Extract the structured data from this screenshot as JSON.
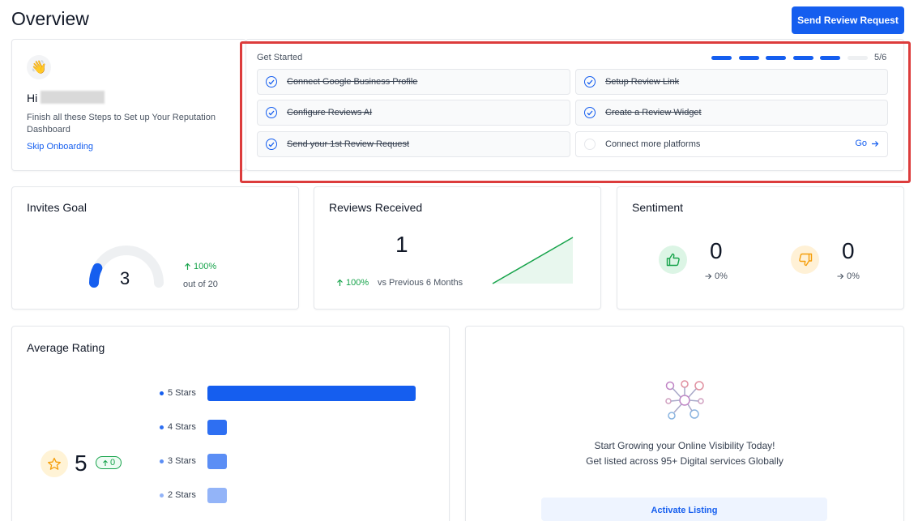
{
  "page": {
    "title": "Overview"
  },
  "header": {
    "send_review_request": "Send Review Request"
  },
  "welcome": {
    "emoji": "👋",
    "greeting": "Hi",
    "description": "Finish all these Steps to Set up Your Reputation Dashboard",
    "skip": "Skip Onboarding"
  },
  "get_started": {
    "title": "Get Started",
    "progress_text": "5/6",
    "progress_completed": 5,
    "progress_total": 6,
    "steps": [
      {
        "label": "Connect Google Business Profile",
        "done": true
      },
      {
        "label": "Setup Review Link",
        "done": true
      },
      {
        "label": "Configure Reviews AI",
        "done": true
      },
      {
        "label": "Create a Review Widget",
        "done": true
      },
      {
        "label": "Send your 1st Review Request",
        "done": true
      },
      {
        "label": "Connect more platforms",
        "done": false,
        "action": "Go"
      }
    ]
  },
  "invites_goal": {
    "title": "Invites Goal",
    "value": "3",
    "change": "100%",
    "out_of": "out of 20",
    "fill_fraction": 0.15
  },
  "reviews_received": {
    "title": "Reviews Received",
    "value": "1",
    "change": "100%",
    "comparison": "vs Previous 6 Months"
  },
  "sentiment": {
    "title": "Sentiment",
    "positive": {
      "value": "0",
      "change": "0%"
    },
    "negative": {
      "value": "0",
      "change": "0%"
    }
  },
  "average_rating": {
    "title": "Average Rating",
    "value": "5",
    "change": "0"
  },
  "chart_data": {
    "type": "bar",
    "orientation": "horizontal",
    "categories": [
      "5 Stars",
      "4 Stars",
      "3 Stars",
      "2 Stars"
    ],
    "values": [
      1,
      0,
      0,
      0
    ],
    "colors": [
      "#155eef",
      "#2e6ff2",
      "#5b8ef5",
      "#93b4f8"
    ]
  },
  "listing": {
    "line1": "Start Growing your Online Visibility Today!",
    "line2": "Get listed across 95+ Digital services Globally",
    "activate": "Activate Listing"
  },
  "colors": {
    "primary": "#155eef",
    "success": "#16a34a",
    "highlight": "#dc3c3c"
  }
}
